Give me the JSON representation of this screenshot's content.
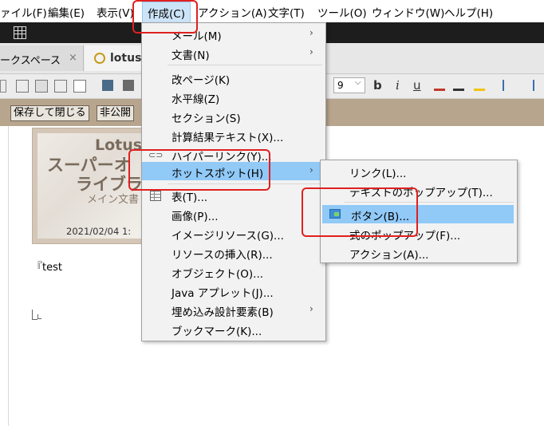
{
  "menubar": {
    "items": [
      "ァイル(F)",
      "編集(E)",
      "表示(V)",
      "作成(C)",
      "アクション(A)",
      "文字(T)",
      "ツール(O)",
      "ウィンドウ(W)",
      "ヘルプ(H)"
    ]
  },
  "tabs": {
    "tab1_label": "ークスペース",
    "tab1_close": "×",
    "tab2_label": "lotus"
  },
  "toolbar": {
    "font_size": "9",
    "dropdown_glyph": "⌵",
    "bold": "b",
    "italic": "i",
    "underline": "u"
  },
  "actionbar": {
    "save_close": "保存して閉じる",
    "private": "非公開"
  },
  "banner": {
    "title1": "Lotus",
    "title2": "スーパーオ",
    "title3": "ライブラ",
    "subtitle": "メイン文書",
    "date": "2021/02/04 1:"
  },
  "document": {
    "text": "『test"
  },
  "create_menu": {
    "items": [
      {
        "label": "メール(M)",
        "submenu": true
      },
      {
        "label": "文書(N)",
        "submenu": true
      },
      {
        "label": "改ページ(K)",
        "submenu": false
      },
      {
        "label": "水平線(Z)",
        "submenu": false
      },
      {
        "label": "セクション(S)",
        "submenu": false
      },
      {
        "label": "計算結果テキスト(X)...",
        "submenu": false
      },
      {
        "label": "ハイパーリンク(Y)...",
        "submenu": false
      },
      {
        "label": "ホットスポット(H)",
        "submenu": true
      },
      {
        "label": "表(T)...",
        "submenu": false
      },
      {
        "label": "画像(P)...",
        "submenu": false
      },
      {
        "label": "イメージリソース(G)...",
        "submenu": false
      },
      {
        "label": "リソースの挿入(R)...",
        "submenu": false
      },
      {
        "label": "オブジェクト(O)...",
        "submenu": false
      },
      {
        "label": "Java アプレット(J)...",
        "submenu": false
      },
      {
        "label": "埋め込み設計要素(B)",
        "submenu": true
      },
      {
        "label": "ブックマーク(K)...",
        "submenu": false
      }
    ],
    "arrow": "›"
  },
  "hotspot_menu": {
    "items": [
      "リンク(L)...",
      "テキストのポップアップ(T)...",
      "ボタン(B)...",
      "式のポップアップ(F)...",
      "アクション(A)..."
    ]
  },
  "colors": {
    "highlight": "#91c9f7",
    "annotation": "#e02020",
    "actionbar": "#b8a58e"
  }
}
